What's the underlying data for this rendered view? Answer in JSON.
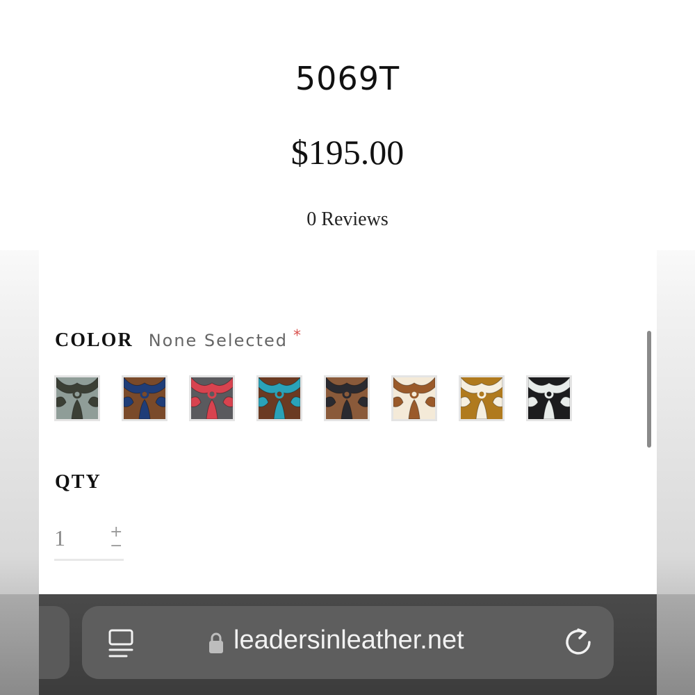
{
  "product": {
    "title": "5069T",
    "price": "$195.00",
    "reviews": "0 Reviews"
  },
  "color_option": {
    "label": "COLOR",
    "value": "None Selected",
    "required_marker": "*",
    "swatches": [
      {
        "name": "gray-cream tooled leather",
        "base": "#8f9d98",
        "accent": "#3b3f35"
      },
      {
        "name": "navy-brown tooled leather",
        "base": "#7a4a2a",
        "accent": "#1f3d78"
      },
      {
        "name": "red-gray tooled leather",
        "base": "#5a5a5e",
        "accent": "#d8434f"
      },
      {
        "name": "turquoise-brown tooled leather",
        "base": "#6b3a22",
        "accent": "#2aa2b8"
      },
      {
        "name": "black-brown tooled leather",
        "base": "#8a5a3a",
        "accent": "#2a2a30"
      },
      {
        "name": "brown-cream tooled leather",
        "base": "#f4ead8",
        "accent": "#9a5a2a"
      },
      {
        "name": "gold-cream tooled leather",
        "base": "#b07a1e",
        "accent": "#f6efe0"
      },
      {
        "name": "black-white tooled leather",
        "base": "#1c1c1e",
        "accent": "#e8ecea"
      }
    ]
  },
  "quantity": {
    "label": "QTY",
    "value": "1",
    "increment_symbol": "+",
    "decrement_symbol": "−"
  },
  "browser": {
    "url": "leadersinleather.net",
    "icons": [
      "reader-mode-icon",
      "lock-icon",
      "reload-icon"
    ]
  },
  "colors": {
    "required": "#d9534f",
    "toolbar": "#3c3c3c",
    "address_bar": "#5e5e5e"
  }
}
